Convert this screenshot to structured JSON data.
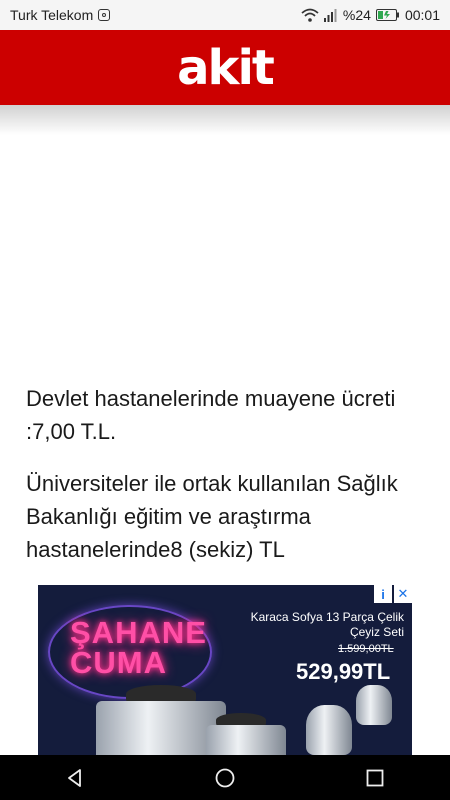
{
  "status_bar": {
    "carrier": "Turk Telekom",
    "battery": "%24",
    "time": "00:01"
  },
  "header": {
    "logo": "akit"
  },
  "article": {
    "paragraphs": [
      "Devlet hastanelerinde muayene ücreti :7,00 T.L.",
      "Üniversiteler ile ortak kullanılan Sağlık Bakanlığı eğitim ve araştırma hastanelerinde8  (sekiz)  TL"
    ]
  },
  "ad": {
    "headline_line1": "ŞAHANE",
    "headline_line2": "CUMA",
    "product": "Karaca Sofya 13 Parça Çelik Çeyiz Seti",
    "old_price": "1.599,00TL",
    "price": "529,99TL",
    "info_label": "i",
    "close_label": "✕"
  },
  "icons": {
    "instagram": "instagram-icon",
    "wifi": "wifi-icon",
    "signal": "signal-icon",
    "battery": "battery-icon",
    "back": "back-icon",
    "home": "home-icon",
    "recents": "recents-icon"
  },
  "colors": {
    "brand_red": "#cc0000",
    "ad_background": "#141c3c",
    "neon_pink": "#ff4fa6"
  }
}
